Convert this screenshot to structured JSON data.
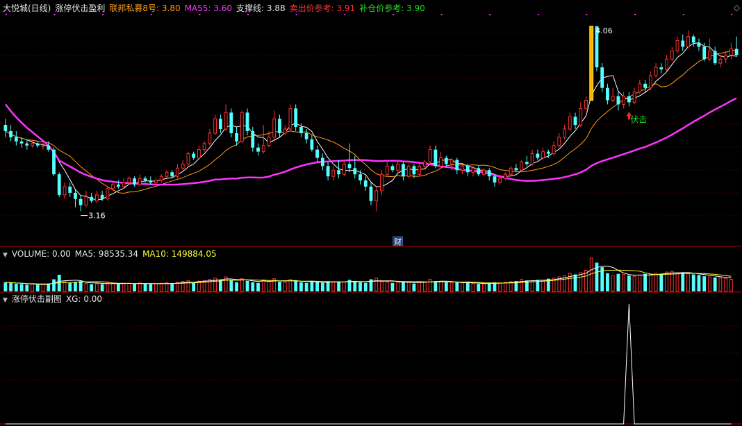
{
  "main_header": {
    "title": "大悦城(日线)",
    "indicator_name": "涨停伏击盈利",
    "line1_label": "联邦私募8号: 3.80",
    "line2_label": "MA55: 3.60",
    "line3_label": "支撑线: 3.88",
    "line4_label": "卖出价参考: 3.91",
    "line5_label": "补仓价参考: 3.90"
  },
  "main_chart": {
    "high_label": "4.06",
    "low_label": "3.16",
    "signal_label": "伏击",
    "event_badge": "财"
  },
  "volume_header": {
    "label": "VOLUME: 0.00",
    "ma5": "MA5: 98535.34",
    "ma10": "MA10: 149884.05"
  },
  "sub_header": {
    "label": "涨停伏击副图",
    "xg": "XG: 0.00"
  },
  "colors": {
    "up": "#ff3232",
    "down": "#54ffff",
    "limit_up_fill": "#ffaa00",
    "ma55": "#ff33ff",
    "ma_fast": "#ffffff",
    "ma_slow": "#ff9f1a",
    "grid": "#7a0000",
    "signal": "#22dd22"
  },
  "chart_data": [
    {
      "type": "candlestick",
      "title": "大悦城(日线)",
      "ylim": [
        3.0,
        4.12
      ],
      "bars": [
        [
          3.58,
          3.55,
          3.61,
          3.52
        ],
        [
          3.55,
          3.52,
          3.58,
          3.5
        ],
        [
          3.52,
          3.5,
          3.55,
          3.48
        ],
        [
          3.5,
          3.49,
          3.52,
          3.47
        ],
        [
          3.49,
          3.48,
          3.51,
          3.46
        ],
        [
          3.48,
          3.49,
          3.51,
          3.47
        ],
        [
          3.49,
          3.48,
          3.5,
          3.47
        ],
        [
          3.48,
          3.48,
          3.5,
          3.46
        ],
        [
          3.48,
          3.46,
          3.5,
          3.45
        ],
        [
          3.46,
          3.34,
          3.47,
          3.33
        ],
        [
          3.34,
          3.24,
          3.35,
          3.23
        ],
        [
          3.24,
          3.28,
          3.3,
          3.22
        ],
        [
          3.28,
          3.25,
          3.3,
          3.23
        ],
        [
          3.25,
          3.22,
          3.27,
          3.18
        ],
        [
          3.22,
          3.19,
          3.24,
          3.16
        ],
        [
          3.19,
          3.23,
          3.26,
          3.18
        ],
        [
          3.23,
          3.21,
          3.25,
          3.2
        ],
        [
          3.21,
          3.24,
          3.26,
          3.2
        ],
        [
          3.24,
          3.22,
          3.26,
          3.21
        ],
        [
          3.22,
          3.27,
          3.28,
          3.21
        ],
        [
          3.27,
          3.29,
          3.3,
          3.26
        ],
        [
          3.29,
          3.28,
          3.31,
          3.27
        ],
        [
          3.28,
          3.3,
          3.32,
          3.27
        ],
        [
          3.3,
          3.32,
          3.33,
          3.29
        ],
        [
          3.32,
          3.29,
          3.33,
          3.28
        ],
        [
          3.29,
          3.32,
          3.34,
          3.28
        ],
        [
          3.32,
          3.31,
          3.33,
          3.3
        ],
        [
          3.31,
          3.3,
          3.33,
          3.29
        ],
        [
          3.3,
          3.31,
          3.32,
          3.29
        ],
        [
          3.31,
          3.33,
          3.34,
          3.3
        ],
        [
          3.33,
          3.35,
          3.36,
          3.32
        ],
        [
          3.35,
          3.33,
          3.36,
          3.32
        ],
        [
          3.33,
          3.37,
          3.39,
          3.32
        ],
        [
          3.37,
          3.39,
          3.41,
          3.36
        ],
        [
          3.39,
          3.44,
          3.45,
          3.38
        ],
        [
          3.44,
          3.42,
          3.45,
          3.41
        ],
        [
          3.42,
          3.46,
          3.48,
          3.41
        ],
        [
          3.46,
          3.49,
          3.5,
          3.45
        ],
        [
          3.49,
          3.54,
          3.56,
          3.48
        ],
        [
          3.54,
          3.61,
          3.63,
          3.53
        ],
        [
          3.61,
          3.56,
          3.63,
          3.54
        ],
        [
          3.56,
          3.64,
          3.68,
          3.55
        ],
        [
          3.64,
          3.54,
          3.66,
          3.52
        ],
        [
          3.54,
          3.5,
          3.57,
          3.48
        ],
        [
          3.5,
          3.64,
          3.65,
          3.49
        ],
        [
          3.64,
          3.55,
          3.66,
          3.53
        ],
        [
          3.55,
          3.47,
          3.57,
          3.45
        ],
        [
          3.47,
          3.45,
          3.49,
          3.43
        ],
        [
          3.45,
          3.48,
          3.58,
          3.44
        ],
        [
          3.48,
          3.52,
          3.55,
          3.47
        ],
        [
          3.52,
          3.61,
          3.65,
          3.5
        ],
        [
          3.61,
          3.54,
          3.63,
          3.52
        ],
        [
          3.54,
          3.56,
          3.58,
          3.53
        ],
        [
          3.56,
          3.66,
          3.68,
          3.55
        ],
        [
          3.66,
          3.57,
          3.68,
          3.55
        ],
        [
          3.57,
          3.54,
          3.59,
          3.52
        ],
        [
          3.54,
          3.51,
          3.56,
          3.49
        ],
        [
          3.51,
          3.46,
          3.53,
          3.45
        ],
        [
          3.46,
          3.42,
          3.48,
          3.4
        ],
        [
          3.42,
          3.38,
          3.44,
          3.36
        ],
        [
          3.38,
          3.33,
          3.4,
          3.31
        ],
        [
          3.33,
          3.36,
          3.38,
          3.31
        ],
        [
          3.36,
          3.34,
          3.41,
          3.32
        ],
        [
          3.34,
          3.39,
          3.41,
          3.33
        ],
        [
          3.39,
          3.37,
          3.49,
          3.35
        ],
        [
          3.37,
          3.34,
          3.43,
          3.32
        ],
        [
          3.34,
          3.31,
          3.36,
          3.29
        ],
        [
          3.31,
          3.28,
          3.33,
          3.26
        ],
        [
          3.28,
          3.21,
          3.3,
          3.19
        ],
        [
          3.21,
          3.26,
          3.28,
          3.16
        ],
        [
          3.26,
          3.34,
          3.36,
          3.24
        ],
        [
          3.34,
          3.38,
          3.4,
          3.33
        ],
        [
          3.38,
          3.36,
          3.39,
          3.35
        ],
        [
          3.36,
          3.39,
          3.41,
          3.35
        ],
        [
          3.39,
          3.33,
          3.4,
          3.31
        ],
        [
          3.33,
          3.38,
          3.39,
          3.32
        ],
        [
          3.38,
          3.34,
          3.39,
          3.32
        ],
        [
          3.34,
          3.38,
          3.39,
          3.33
        ],
        [
          3.38,
          3.4,
          3.41,
          3.37
        ],
        [
          3.4,
          3.46,
          3.48,
          3.39
        ],
        [
          3.46,
          3.38,
          3.48,
          3.37
        ],
        [
          3.38,
          3.42,
          3.45,
          3.37
        ],
        [
          3.42,
          3.39,
          3.43,
          3.38
        ],
        [
          3.39,
          3.41,
          3.42,
          3.36
        ],
        [
          3.41,
          3.36,
          3.42,
          3.34
        ],
        [
          3.36,
          3.38,
          3.39,
          3.34
        ],
        [
          3.38,
          3.35,
          3.39,
          3.33
        ],
        [
          3.35,
          3.37,
          3.38,
          3.33
        ],
        [
          3.37,
          3.34,
          3.38,
          3.33
        ],
        [
          3.34,
          3.36,
          3.37,
          3.33
        ],
        [
          3.36,
          3.33,
          3.37,
          3.31
        ],
        [
          3.33,
          3.3,
          3.34,
          3.28
        ],
        [
          3.3,
          3.32,
          3.34,
          3.29
        ],
        [
          3.32,
          3.34,
          3.35,
          3.31
        ],
        [
          3.34,
          3.37,
          3.38,
          3.33
        ],
        [
          3.37,
          3.36,
          3.39,
          3.35
        ],
        [
          3.36,
          3.4,
          3.41,
          3.35
        ],
        [
          3.4,
          3.39,
          3.43,
          3.38
        ],
        [
          3.39,
          3.44,
          3.46,
          3.38
        ],
        [
          3.44,
          3.42,
          3.46,
          3.41
        ],
        [
          3.42,
          3.45,
          3.47,
          3.41
        ],
        [
          3.45,
          3.44,
          3.46,
          3.42
        ],
        [
          3.44,
          3.48,
          3.5,
          3.43
        ],
        [
          3.48,
          3.52,
          3.54,
          3.47
        ],
        [
          3.52,
          3.56,
          3.58,
          3.51
        ],
        [
          3.56,
          3.62,
          3.64,
          3.55
        ],
        [
          3.62,
          3.58,
          3.64,
          3.56
        ],
        [
          3.58,
          3.66,
          3.69,
          3.57
        ],
        [
          3.66,
          3.7,
          3.72,
          3.65
        ],
        [
          3.7,
          4.06,
          4.06,
          3.7
        ],
        [
          4.06,
          3.86,
          4.06,
          3.84
        ],
        [
          3.86,
          3.76,
          3.88,
          3.74
        ],
        [
          3.76,
          3.7,
          3.78,
          3.68
        ],
        [
          3.7,
          3.72,
          3.76,
          3.69
        ],
        [
          3.72,
          3.68,
          3.74,
          3.65
        ],
        [
          3.68,
          3.72,
          3.74,
          3.66
        ],
        [
          3.72,
          3.69,
          3.74,
          3.67
        ],
        [
          3.69,
          3.74,
          3.76,
          3.68
        ],
        [
          3.74,
          3.78,
          3.8,
          3.73
        ],
        [
          3.78,
          3.76,
          3.8,
          3.74
        ],
        [
          3.76,
          3.82,
          3.84,
          3.75
        ],
        [
          3.82,
          3.86,
          3.88,
          3.81
        ],
        [
          3.86,
          3.85,
          3.88,
          3.83
        ],
        [
          3.85,
          3.9,
          3.92,
          3.84
        ],
        [
          3.9,
          3.94,
          3.96,
          3.89
        ],
        [
          3.94,
          3.99,
          4.01,
          3.93
        ],
        [
          3.99,
          3.96,
          4.02,
          3.94
        ],
        [
          3.96,
          4.01,
          4.04,
          3.95
        ],
        [
          4.01,
          3.98,
          4.02,
          3.96
        ],
        [
          3.98,
          3.96,
          4.0,
          3.94
        ],
        [
          3.96,
          3.9,
          3.98,
          3.89
        ],
        [
          3.9,
          3.94,
          4.0,
          3.89
        ],
        [
          3.94,
          3.88,
          3.96,
          3.87
        ],
        [
          3.88,
          3.9,
          3.92,
          3.86
        ],
        [
          3.9,
          3.92,
          3.94,
          3.88
        ],
        [
          3.92,
          3.95,
          3.98,
          3.9
        ],
        [
          3.95,
          3.92,
          4.01,
          3.91
        ]
      ]
    },
    {
      "type": "bar",
      "title": "VOLUME",
      "values": [
        30,
        28,
        25,
        24,
        22,
        24,
        22,
        23,
        26,
        40,
        55,
        32,
        28,
        30,
        34,
        26,
        24,
        25,
        24,
        28,
        27,
        25,
        26,
        27,
        25,
        28,
        25,
        24,
        25,
        27,
        29,
        25,
        30,
        33,
        36,
        28,
        34,
        36,
        40,
        44,
        38,
        48,
        36,
        30,
        42,
        35,
        30,
        28,
        38,
        34,
        42,
        32,
        30,
        40,
        35,
        30,
        28,
        32,
        30,
        28,
        34,
        32,
        30,
        32,
        38,
        34,
        30,
        28,
        40,
        44,
        32,
        30,
        28,
        30,
        32,
        30,
        26,
        30,
        32,
        40,
        34,
        32,
        30,
        28,
        30,
        28,
        28,
        26,
        25,
        24,
        28,
        30,
        28,
        30,
        32,
        34,
        40,
        36,
        34,
        38,
        36,
        42,
        44,
        48,
        52,
        60,
        56,
        62,
        70,
        110,
        95,
        80,
        60,
        52,
        58,
        56,
        52,
        50,
        54,
        58,
        56,
        60,
        58,
        64,
        66,
        60,
        62,
        58,
        56,
        54,
        50,
        48,
        46,
        44,
        42,
        40
      ]
    },
    {
      "type": "line",
      "title": "涨停伏击副图",
      "series": [
        {
          "name": "XG",
          "values": [
            0,
            0,
            0,
            0,
            0,
            0,
            0,
            0,
            0,
            0,
            0,
            0,
            0,
            0,
            0,
            0,
            0,
            0,
            0,
            0,
            0,
            0,
            0,
            0,
            0,
            0,
            0,
            0,
            0,
            0,
            0,
            0,
            0,
            0,
            0,
            0,
            0,
            0,
            0,
            0,
            0,
            0,
            0,
            0,
            0,
            0,
            0,
            0,
            0,
            0,
            0,
            0,
            0,
            0,
            0,
            0,
            0,
            0,
            0,
            0,
            0,
            0,
            0,
            0,
            0,
            0,
            0,
            0,
            0,
            0,
            0,
            0,
            0,
            0,
            0,
            0,
            0,
            0,
            0,
            0,
            0,
            0,
            0,
            0,
            0,
            0,
            0,
            0,
            0,
            0,
            0,
            0,
            0,
            0,
            0,
            0,
            0,
            0,
            0,
            0,
            0,
            0,
            0,
            0,
            0,
            0,
            0,
            0,
            0,
            0,
            0,
            0,
            0,
            0,
            0,
            0,
            1,
            0,
            0,
            0,
            0,
            0,
            0,
            0,
            0,
            0,
            0,
            0,
            0,
            0,
            0,
            0,
            0,
            0,
            0,
            0
          ]
        }
      ]
    }
  ]
}
